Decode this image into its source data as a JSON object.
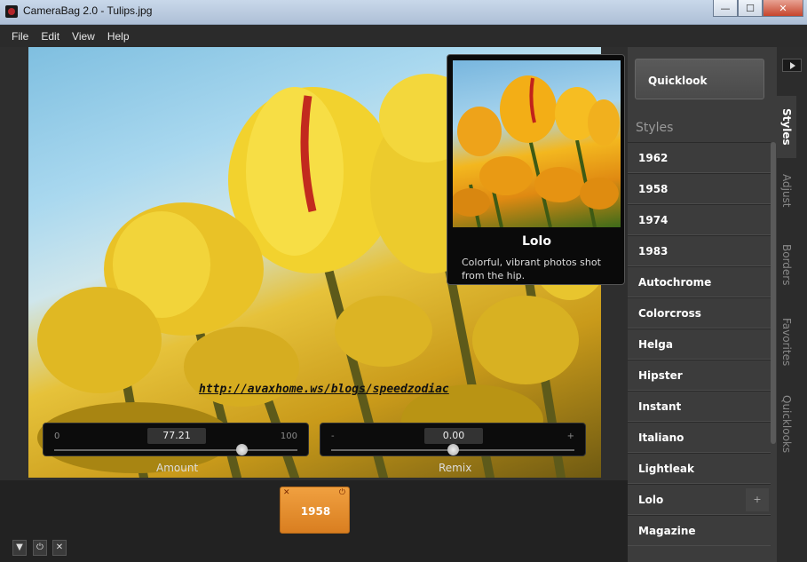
{
  "window": {
    "title": "CameraBag 2.0 - Tulips.jpg",
    "minimize": "—",
    "maximize": "☐",
    "close": "✕"
  },
  "menu": [
    "File",
    "Edit",
    "View",
    "Help"
  ],
  "watermark": "http://avaxhome.ws/blogs/speedzodiac",
  "amount_slider": {
    "label": "Amount",
    "min": "0",
    "max": "100",
    "value": "77.21",
    "level": 0.7721
  },
  "remix_slider": {
    "label": "Remix",
    "min": "-",
    "max": "+",
    "value": "0.00",
    "level": 0.5
  },
  "tooltip": {
    "title": "Lolo",
    "description": "Colorful, vibrant photos shot from the hip."
  },
  "preset_card": {
    "label": "1958",
    "remove": "✕",
    "power": "⏻"
  },
  "tray_buttons": {
    "collapse": "▼",
    "power": "⏻",
    "close": "✕"
  },
  "panel": {
    "quicklook": "Quicklook",
    "styles_heading": "Styles",
    "styles": [
      "1962",
      "1958",
      "1974",
      "1983",
      "Autochrome",
      "Colorcross",
      "Helga",
      "Hipster",
      "Instant",
      "Italiano",
      "Lightleak",
      "Lolo",
      "Magazine"
    ],
    "add_label": "+"
  },
  "tabs": [
    "Styles",
    "Adjust",
    "Borders",
    "Favorites",
    "Quicklooks"
  ],
  "active_tab": "Styles"
}
